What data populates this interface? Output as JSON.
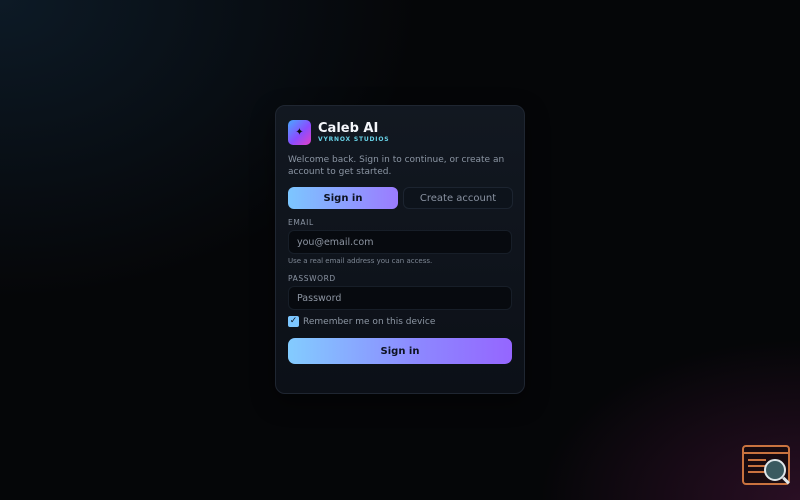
{
  "brand": {
    "app_name": "Caleb AI",
    "studio": "VYRNOX STUDIOS",
    "logo_glyph": "✦"
  },
  "welcome_text": "Welcome back. Sign in to continue, or create an account to get started.",
  "tabs": [
    {
      "label": "Sign in",
      "active": true
    },
    {
      "label": "Create account",
      "active": false
    }
  ],
  "email": {
    "label": "EMAIL",
    "placeholder": "you@email.com",
    "value": "",
    "hint": "Use a real email address you can access."
  },
  "password": {
    "label": "PASSWORD",
    "placeholder": "Password",
    "value": ""
  },
  "remember": {
    "label": "Remember me on this device",
    "checked": true,
    "check_glyph": "✓"
  },
  "submit_label": "Sign in",
  "colors": {
    "accent_start": "#7cc6ff",
    "accent_end": "#9566ff",
    "background": "#050608",
    "card": "#121821"
  },
  "corner_widget_icon": "terminal-search-icon"
}
